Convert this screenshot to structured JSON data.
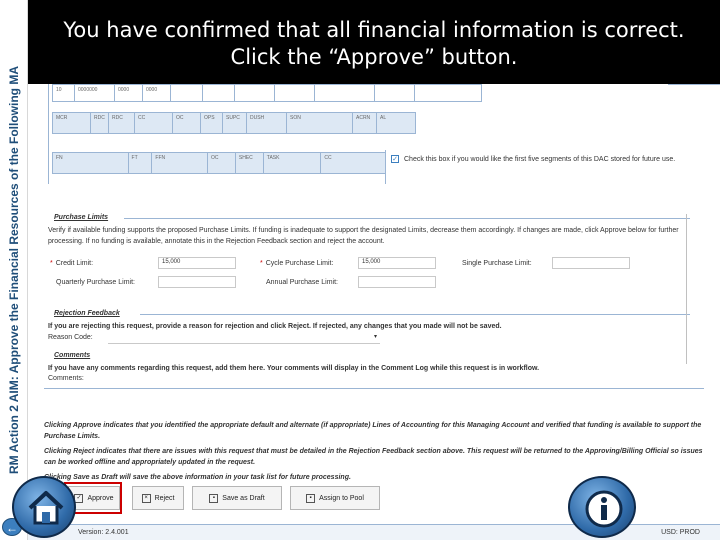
{
  "side_banner": {
    "text": "RM Action 2 AIM: Approve the Financial Resources of the Following MA"
  },
  "instruction": {
    "line1": "You have confirmed that all financial information is correct.",
    "line2": "Click the “Approve” button."
  },
  "accounting_grid": {
    "row1": [
      "10",
      "0000000",
      "0000",
      "0000",
      "",
      "",
      "",
      "",
      "",
      "",
      ""
    ],
    "row2_headers": [
      "MCR",
      "RDC",
      "RDC",
      "CC",
      "OC",
      "OPS",
      "SUPC",
      "DUSH",
      "SON",
      "ACRN",
      "AL"
    ],
    "row3_headers": [
      "FN",
      "FT",
      "FFN",
      "OC",
      "SHEC",
      "TASK",
      "CC"
    ]
  },
  "save_dac": {
    "checked": true,
    "text": "Check this box if you would like the first five segments of this DAC stored for future use."
  },
  "purchase_limits": {
    "title": "Purchase Limits",
    "instructions": "Verify if available funding supports the proposed Purchase Limits. If funding is inadequate to support the designated Limits, decrease them accordingly. If changes are made, click Approve below for further processing. If no funding is available, annotate this in the Rejection Feedback section and reject the account.",
    "credit_limit_label": "Credit Limit:",
    "credit_limit_value": "15,000",
    "cycle_limit_label": "Cycle Purchase Limit:",
    "cycle_limit_value": "15,000",
    "single_limit_label": "Single Purchase Limit:",
    "single_limit_value": "",
    "quarterly_limit_label": "Quarterly Purchase Limit:",
    "quarterly_limit_value": "",
    "annual_limit_label": "Annual Purchase Limit:",
    "annual_limit_value": ""
  },
  "rejection_feedback": {
    "title": "Rejection Feedback",
    "instructions": "If you are rejecting this request, provide a reason for rejection and click Reject. If rejected, any changes that you made will not be saved.",
    "reason_code_label": "Reason Code:"
  },
  "comments": {
    "title": "Comments",
    "instructions": "If you have any comments regarding this request, add them here. Your comments will display in the Comment Log while this request is in workflow.",
    "comments_label": "Comments:"
  },
  "footer_notes": {
    "approve_note": "Clicking Approve indicates that you identified the appropriate default and alternate (if appropriate) Lines of Accounting for this Managing Account and verified that funding is available to support the Purchase Limits.",
    "reject_note": "Clicking Reject indicates that there are issues with this request that must be detailed in the Rejection Feedback section above. This request will be returned to the Approving/Billing Official so issues can be worked offline and appropriately updated in the request.",
    "draft_note": "Clicking Save as Draft will save the above information in your task list for future processing."
  },
  "buttons": {
    "approve": "Approve",
    "reject": "Reject",
    "save_draft": "Save as Draft",
    "assign_pool": "Assign to Pool"
  },
  "status_bar": {
    "version": "Version: 2.4.001",
    "environment": "USD: PROD"
  },
  "colors": {
    "header_bg": "#000000",
    "banner_text": "#1f4e79",
    "highlight": "#cc0000",
    "grid_border": "#9bb5d4"
  },
  "icons": {
    "back": "arrow-left-icon",
    "home": "home-icon",
    "info": "info-icon"
  }
}
